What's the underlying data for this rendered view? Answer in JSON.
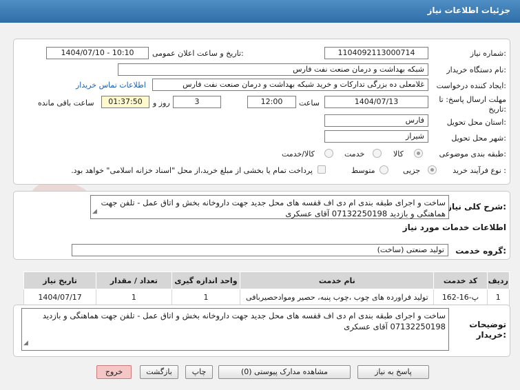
{
  "window": {
    "title": "جزئیات اطلاعات نیاز"
  },
  "form": {
    "need_number_label": "شماره نیاز:",
    "need_number": "1104092113000714",
    "announce_label": "تاریخ و ساعت اعلان عمومی:",
    "announce_value": "1404/07/10 - 10:10",
    "buyer_org_label": "نام دستگاه خریدار:",
    "buyer_org": "شبکه بهداشت و درمان صنعت نفت فارس",
    "creator_label": "ایجاد کننده درخواست:",
    "creator": "غلامعلی ده بزرگی تدارکات و خرید شبکه بهداشت و درمان صنعت نفت فارس",
    "contact_link": "اطلاعات تماس خریدار",
    "deadline_label_1": "مهلت ارسال پاسخ: تا",
    "deadline_label_2": "تاریخ:",
    "deadline_date": "1404/07/13",
    "time_label": "ساعت",
    "deadline_time": "12:00",
    "days_value": "3",
    "days_label": "روز و",
    "remaining_time": "01:37:50",
    "remaining_label": "ساعت باقی مانده",
    "province_label": "استان محل تحویل:",
    "province": "فارس",
    "city_label": "شهر محل تحویل:",
    "city": "شیراز",
    "category_label": "طبقه بندی موضوعی:",
    "category_options": [
      "کالا",
      "خدمت",
      "کالا/خدمت"
    ],
    "process_label": "نوع فرآیند خرید :",
    "process_options": [
      "جزیی",
      "متوسط"
    ],
    "payment_note": "پرداخت تمام یا بخشی از مبلغ خرید،از محل \"اسناد خزانه اسلامی\" خواهد بود."
  },
  "description": {
    "label": "شرح کلی نیاز:",
    "text": "ساخت و اجرای طبقه بندی ام دی اف قفسه های محل جدید جهت داروخانه بخش و اتاق عمل - تلفن جهت هماهنگی و بازدید 07132250198 آقای عسکری"
  },
  "services": {
    "heading": "اطلاعات خدمات مورد نیاز",
    "group_label": "گروه خدمت:",
    "group_value": "تولید صنعتی (ساخت)",
    "columns": [
      "ردیف",
      "کد خدمت",
      "نام خدمت",
      "واحد اندازه گیری",
      "تعداد / مقدار",
      "تاریخ نیاز"
    ],
    "rows": [
      [
        "1",
        "پ-16-162",
        "تولید فراورده های چوب ،چوب پنبه، حصیر وموادحصیربافی",
        "1",
        "1",
        "1404/07/17"
      ]
    ]
  },
  "buyer_notes": {
    "label_1": "توضیحات",
    "label_2": "خریدار:",
    "text": "ساخت و اجرای طبقه بندی ام دی اف قفسه های محل جدید جهت داروخانه بخش و اتاق عمل - تلفن جهت هماهنگی و بازدید 07132250198 آقای عسکری"
  },
  "buttons": {
    "reply": "پاسخ به نیاز",
    "attachments": "مشاهده مدارک پیوستی (0)",
    "print": "چاپ",
    "back": "بازگشت",
    "exit": "خروج"
  },
  "watermark": {
    "text": "AriaTender.net"
  },
  "colors": {
    "title_bar": "#3d7fb8",
    "highlight": "#fffacd",
    "link": "#1a5fb4",
    "exit_button": "#f4c6c6"
  }
}
